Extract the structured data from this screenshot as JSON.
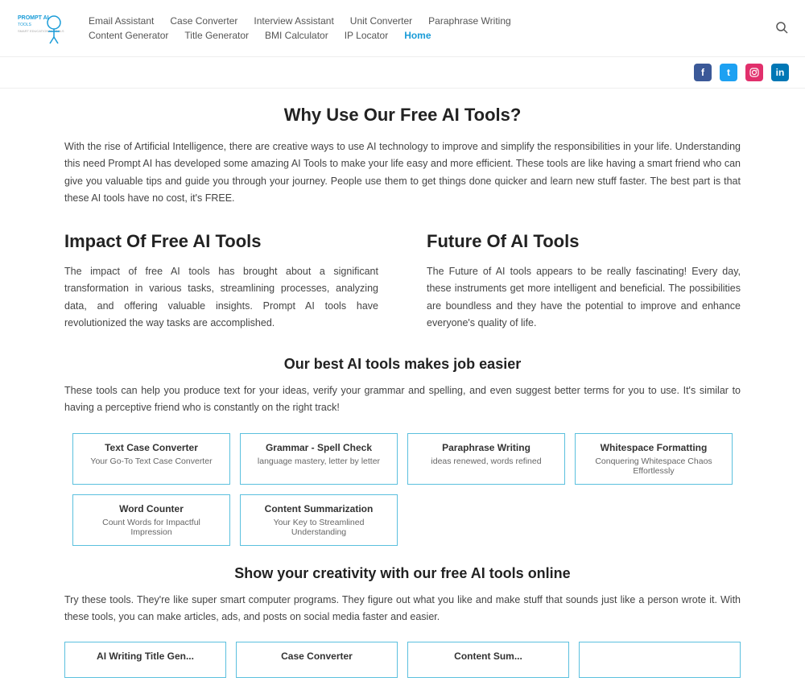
{
  "header": {
    "logo_alt": "Prompt AI Tools",
    "nav_top": [
      {
        "label": "Email Assistant",
        "active": false
      },
      {
        "label": "Case Converter",
        "active": false
      },
      {
        "label": "Interview Assistant",
        "active": false
      },
      {
        "label": "Unit Converter",
        "active": false
      },
      {
        "label": "Paraphrase Writing",
        "active": false
      }
    ],
    "nav_bottom": [
      {
        "label": "Content Generator",
        "active": false
      },
      {
        "label": "Title Generator",
        "active": false
      },
      {
        "label": "BMI Calculator",
        "active": false
      },
      {
        "label": "IP Locator",
        "active": false
      },
      {
        "label": "Home",
        "active": true
      }
    ]
  },
  "social": {
    "icons": [
      {
        "name": "facebook",
        "label": "f",
        "class": "fb"
      },
      {
        "name": "twitter",
        "label": "t",
        "class": "tw"
      },
      {
        "name": "instagram",
        "label": "in",
        "class": "ig"
      },
      {
        "name": "linkedin",
        "label": "li",
        "class": "li"
      }
    ]
  },
  "why_section": {
    "title": "Why Use Our Free AI Tools?",
    "text": "With the rise of Artificial Intelligence, there are creative ways to use AI technology to improve and simplify the responsibilities in your life. Understanding this need Prompt AI has developed some amazing AI Tools to make your life easy and more efficient. These tools are like having a smart friend who can give you valuable tips and guide you through your journey. People use them to get things done quicker and learn new stuff faster. The best part is that these AI tools have no cost, it's FREE."
  },
  "impact_section": {
    "title": "Impact Of Free AI Tools",
    "text": "The impact of free AI tools has brought about a significant transformation in various tasks, streamlining processes, analyzing data, and offering valuable insights. Prompt AI tools have revolutionized the way tasks are accomplished."
  },
  "future_section": {
    "title": "Future Of AI Tools",
    "text": "The Future of AI tools appears to be really fascinating! Every day, these instruments get more intelligent and beneficial. The possibilities are boundless and they have the potential to improve and enhance everyone's quality of life."
  },
  "best_tools_section": {
    "title": "Our best AI tools makes job easier",
    "text": "These tools can help you produce text for your ideas, verify your grammar and spelling, and even suggest better terms for you to use. It's similar to having a perceptive friend who is constantly on the right track!"
  },
  "tool_cards": [
    {
      "title": "Text Case Converter",
      "sub": "Your Go-To Text Case Converter"
    },
    {
      "title": "Grammar - Spell Check",
      "sub": "language mastery, letter by letter"
    },
    {
      "title": "Paraphrase Writing",
      "sub": "ideas renewed, words refined"
    },
    {
      "title": "Whitespace Formatting",
      "sub": "Conquering Whitespace Chaos Effortlessly"
    },
    {
      "title": "Word Counter",
      "sub": "Count Words for Impactful Impression"
    },
    {
      "title": "Content Summarization",
      "sub": "Your Key to Streamlined Understanding"
    },
    {
      "title": "",
      "sub": ""
    },
    {
      "title": "",
      "sub": ""
    }
  ],
  "creativity_section": {
    "title": "Show your creativity with our free AI tools online",
    "text": "Try these tools. They're like super smart computer programs. They figure out what you like and make stuff that sounds just like a person wrote it. With these tools, you can make articles, ads, and posts on social media faster and easier."
  },
  "bottom_tool_cards": [
    {
      "title": "AI Writing Title Gen..."
    },
    {
      "title": "Case Converter"
    },
    {
      "title": "Content Sum..."
    },
    {
      "title": ""
    }
  ]
}
